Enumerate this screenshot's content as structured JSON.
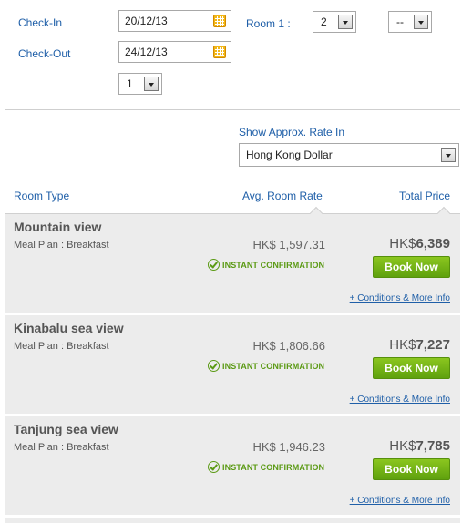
{
  "booking": {
    "checkin_label": "Check-In",
    "checkin_value": "20/12/13",
    "checkout_label": "Check-Out",
    "checkout_value": "24/12/13",
    "room_label": "Room 1 :",
    "adults_value": "2",
    "children_value": "--",
    "rooms_value": "1"
  },
  "currency": {
    "label": "Show Approx. Rate In",
    "selected": "Hong Kong Dollar"
  },
  "table": {
    "col_room_type": "Room Type",
    "col_avg_rate": "Avg. Room Rate",
    "col_total": "Total Price"
  },
  "rooms": [
    {
      "name": "Mountain view",
      "meal": "Meal Plan : Breakfast",
      "avg_rate": "HK$ 1,597.31",
      "total_currency": "HK$",
      "total_amount": "6,389",
      "confirmation": "INSTANT CONFIRMATION",
      "book_label": "Book Now",
      "conditions": "+ Conditions & More Info"
    },
    {
      "name": "Kinabalu sea view",
      "meal": "Meal Plan : Breakfast",
      "avg_rate": "HK$ 1,806.66",
      "total_currency": "HK$",
      "total_amount": "7,227",
      "confirmation": "INSTANT CONFIRMATION",
      "book_label": "Book Now",
      "conditions": "+ Conditions & More Info"
    },
    {
      "name": "Tanjung sea view",
      "meal": "Meal Plan : Breakfast",
      "avg_rate": "HK$ 1,946.23",
      "total_currency": "HK$",
      "total_amount": "7,785",
      "confirmation": "INSTANT CONFIRMATION",
      "book_label": "Book Now",
      "conditions": "+ Conditions & More Info"
    }
  ],
  "colors": {
    "link_blue": "#1f5fa8",
    "book_green": "#6fb114",
    "row_bg": "#ececec"
  }
}
